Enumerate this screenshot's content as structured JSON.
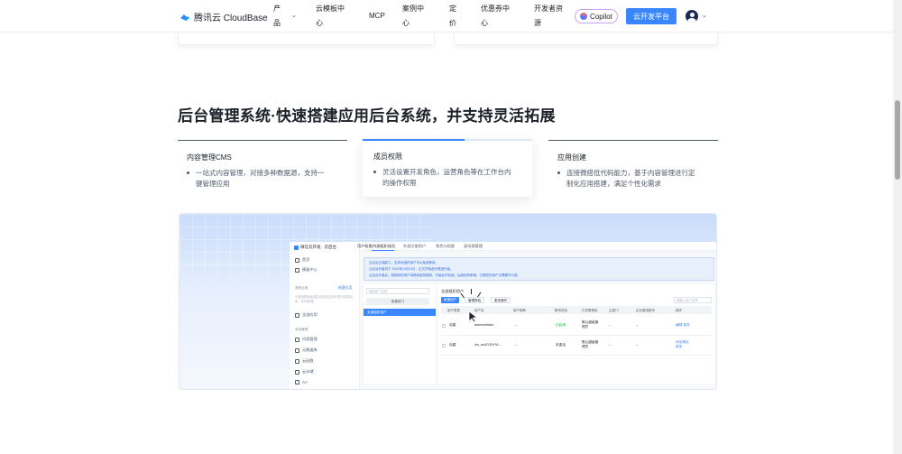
{
  "nav": {
    "brand": "腾讯云 CloudBase",
    "items": [
      {
        "lines": [
          "产",
          "品"
        ],
        "has_chevron": true
      },
      {
        "lines": [
          "云模板中",
          "心"
        ]
      },
      {
        "lines": [
          "MCP"
        ]
      },
      {
        "lines": [
          "案例中",
          "心"
        ]
      },
      {
        "lines": [
          "定",
          "价"
        ]
      },
      {
        "lines": [
          "优惠券中",
          "心"
        ]
      },
      {
        "lines": [
          "开发者资",
          "源"
        ]
      }
    ],
    "copilot_label": "Copilot",
    "primary_button": "云开发平台"
  },
  "section": {
    "title": "后台管理系统·快速搭建应用后台系统，并支持灵活拓展",
    "tabs": [
      {
        "title": "内容管理CMS",
        "desc": [
          "一站式内容管理，对接多种数据源，支持一",
          "键管理应用"
        ],
        "active": false
      },
      {
        "title": "成员权限",
        "desc": [
          "灵活设置开发角色，运营角色等在工作台内",
          "的操作权限"
        ],
        "active": true
      },
      {
        "title": "应用创建",
        "desc": [
          "连接微搭低代码能力，基于内容管理进行定",
          "制化应用搭建，满足个性化需求"
        ],
        "active": false
      }
    ]
  },
  "preview": {
    "console_title": "微信云开发 · 云后台",
    "sidebar": {
      "items_top": [
        "首页",
        "模板中心"
      ],
      "group_my_apps": "我的应用",
      "create_app": "新建应用",
      "note": "可使用模板新建应用或在应用列表中选择应用，在线管理。",
      "all_apps": "全部应用",
      "group_system": "系统管理",
      "items_system": [
        "内容管理",
        "元数据库",
        "云函数",
        "云存储",
        "AI+"
      ]
    },
    "tabs": [
      "用户权限",
      "内部组织成员",
      "外部注册用户",
      "角色与权限",
      "身份源管理"
    ],
    "notice": [
      "云后台云端能力，支持对组织用户可以免费使用。",
      "云后台升级将于 2024年10月31日，正式开始逐步推进升级。",
      "云后台升级后，原授权的用户将继续保持授权，升级后不收费，后续如有新增，已授权的用户无需额外付费。"
    ],
    "search_dept": "搜索部门名称",
    "new_dept": "新建部门",
    "all_users": "全部组织用户",
    "right_title": "全部组织用户",
    "buttons": [
      "新建用户",
      "管理角色",
      "更多操作"
    ],
    "search_user": "请输入用户名称",
    "columns": [
      "用户类型",
      "用户名",
      "用户昵称",
      "账号状态",
      "已关联角色",
      "主部门",
      "企业微信账号",
      "操作"
    ],
    "rows": [
      {
        "type": "自建",
        "username": "administrator",
        "nickname": "--",
        "status": "已启用",
        "role": [
          "默认超级管",
          "理员"
        ],
        "dept": "--",
        "wechat": "--",
        "ops": [
          "编辑 更多"
        ]
      },
      {
        "type": "自建",
        "username": "uin_mc5Y30YVL...",
        "nickname": "--",
        "status": "未激活",
        "role": [
          "默认超级管",
          "理员"
        ],
        "dept": "--",
        "wechat": "--",
        "ops": [
          "添加角色",
          "更多"
        ]
      }
    ]
  }
}
